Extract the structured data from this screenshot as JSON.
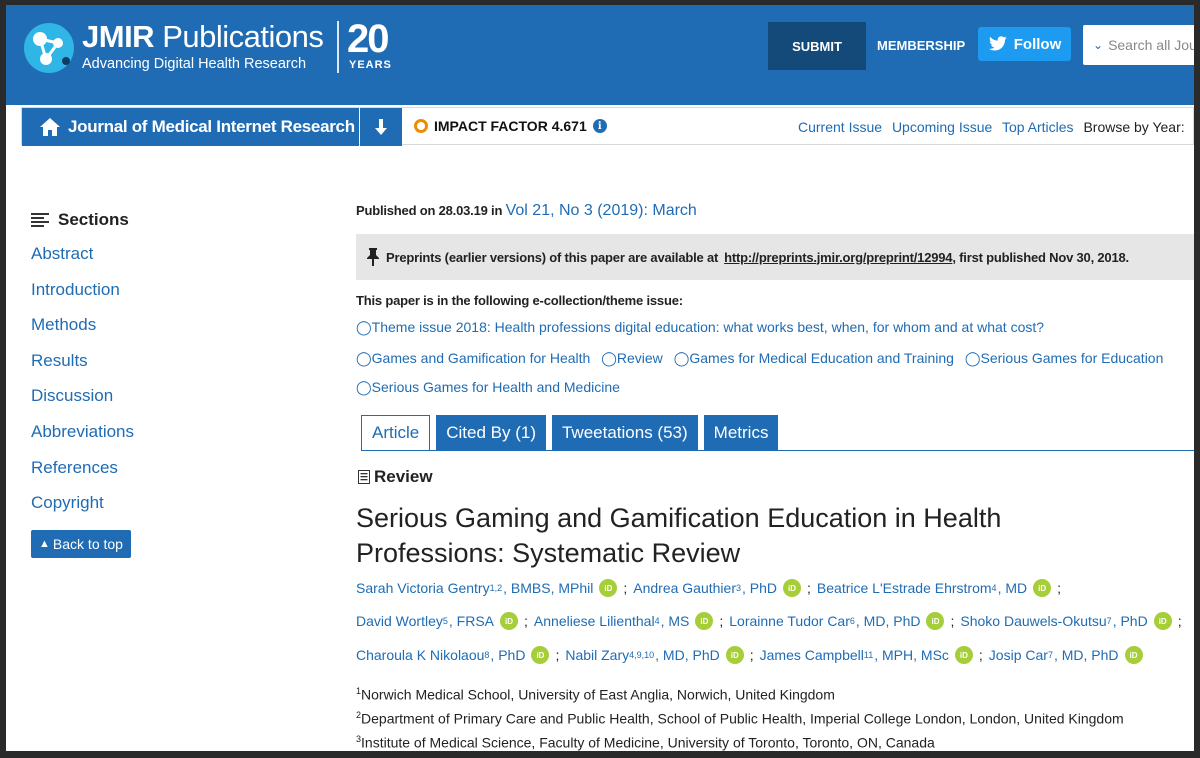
{
  "header": {
    "brand_bold": "JMIR",
    "brand_rest": " Publications",
    "tagline": "Advancing Digital Health Research",
    "anniv_number": "20",
    "anniv_label": "YEARS",
    "submit_label": "SUBMIT",
    "membership_label": "MEMBERSHIP",
    "follow_label": "Follow",
    "search_placeholder": "Search all Jou"
  },
  "journal_bar": {
    "title": "Journal of Medical Internet Research",
    "impact_factor": "IMPACT FACTOR 4.671",
    "links": [
      "Current Issue",
      "Upcoming Issue",
      "Top Articles"
    ],
    "browse_label": "Browse by Year:"
  },
  "sidebar": {
    "heading": "Sections",
    "items": [
      "Abstract",
      "Introduction",
      "Methods",
      "Results",
      "Discussion",
      "Abbreviations",
      "References",
      "Copyright"
    ],
    "back_to_top": "Back to top"
  },
  "article": {
    "published_prefix": "Published on 28.03.19 in ",
    "volume": "Vol 21, No 3 (2019): March",
    "preprint_text": "Preprints (earlier versions) of this paper are available at ",
    "preprint_url": "http://preprints.jmir.org/preprint/12994",
    "preprint_suffix": ", first published Nov 30, 2018.",
    "theme_heading": "This paper is in the following e-collection/theme issue:",
    "themes_line1": [
      "Theme issue 2018: Health professions digital education: what works best, when, for whom and at what cost?"
    ],
    "themes_line2": [
      "Games and Gamification for Health",
      "Review",
      "Games for Medical Education and Training",
      "Serious Games for Education"
    ],
    "themes_line3": [
      "Serious Games for Health and Medicine"
    ],
    "tabs": [
      "Article",
      "Cited By (1)",
      "Tweetations (53)",
      "Metrics"
    ],
    "type": "Review",
    "title": "Serious Gaming and Gamification Education in Health Professions: Systematic Review",
    "authors_line1": [
      {
        "name": "Sarah Victoria Gentry",
        "sup": "1,2",
        "deg": ", BMBS, MPhil"
      },
      {
        "name": "Andrea Gauthier",
        "sup": "3",
        "deg": ", PhD"
      },
      {
        "name": "Beatrice L'Estrade Ehrstrom",
        "sup": "4",
        "deg": ", MD"
      }
    ],
    "authors_line2": [
      {
        "name": "David Wortley",
        "sup": "5",
        "deg": ", FRSA"
      },
      {
        "name": "Anneliese Lilienthal",
        "sup": "4",
        "deg": ", MS"
      },
      {
        "name": "Lorainne Tudor Car",
        "sup": "6",
        "deg": ", MD, PhD"
      },
      {
        "name": "Shoko Dauwels-Okutsu",
        "sup": "7",
        "deg": ", PhD"
      }
    ],
    "authors_line3": [
      {
        "name": "Charoula K Nikolaou",
        "sup": "8",
        "deg": ", PhD"
      },
      {
        "name": "Nabil Zary",
        "sup": "4,9,10",
        "deg": ", MD, PhD"
      },
      {
        "name": "James Campbell",
        "sup": "11",
        "deg": ", MPH, MSc"
      },
      {
        "name": "Josip Car",
        "sup": "7",
        "deg": ", MD, PhD"
      }
    ],
    "orcid_label": "iD",
    "affiliations": [
      {
        "num": "1",
        "text": "Norwich Medical School, University of East Anglia, Norwich, United Kingdom"
      },
      {
        "num": "2",
        "text": "Department of Primary Care and Public Health, School of Public Health, Imperial College London, London, United Kingdom"
      },
      {
        "num": "3",
        "text": "Institute of Medical Science, Faculty of Medicine, University of Toronto, Toronto, ON, Canada"
      }
    ]
  },
  "colors": {
    "brand_blue": "#1f6cb4",
    "dark_blue": "#144a79",
    "twitter_blue": "#1d9bf0",
    "orcid_green": "#a6ce39",
    "impact_orange": "#f08c00"
  }
}
